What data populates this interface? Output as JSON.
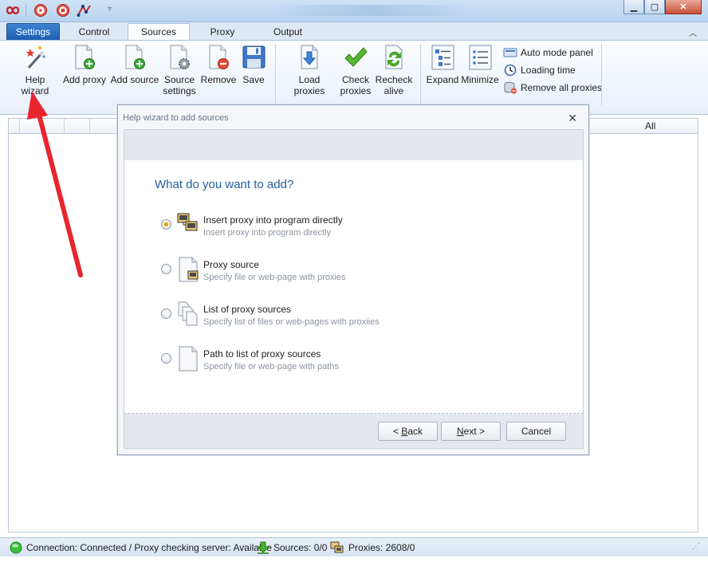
{
  "ribbon_tabs": [
    {
      "label": "Settings"
    },
    {
      "label": "Control"
    },
    {
      "label": "Sources"
    },
    {
      "label": "Proxy"
    },
    {
      "label": "Output"
    }
  ],
  "ribbon": {
    "help_wizard": "Help wizard",
    "add_proxy": "Add proxy",
    "add_source": "Add source",
    "source_settings_l1": "Source",
    "source_settings_l2": "settings",
    "remove": "Remove",
    "save": "Save",
    "load_proxies": "Load proxies",
    "check_proxies_l1": "Check",
    "check_proxies_l2": "proxies",
    "recheck_alive_l1": "Recheck",
    "recheck_alive_l2": "alive",
    "expand": "Expand",
    "minimize": "Minimize",
    "auto_mode_panel": "Auto mode panel",
    "loading_time": "Loading time",
    "remove_all_proxies": "Remove all proxies"
  },
  "grid": {
    "all_header": "All"
  },
  "dialog": {
    "title": "Help wizard to add sources",
    "heading": "What do you want to add?",
    "options": [
      {
        "title": "Insert proxy into program directly",
        "desc": "Insert proxy into program directly",
        "selected": true
      },
      {
        "title": "Proxy source",
        "desc": "Specify file or web-page with proxies",
        "selected": false
      },
      {
        "title": "List of proxy sources",
        "desc": "Specify list of files or web-pages with proxiies",
        "selected": false
      },
      {
        "title": "Path to list of proxy sources",
        "desc": "Specify file or web-page with paths",
        "selected": false
      }
    ],
    "back_prefix": "< ",
    "back_accel": "B",
    "back_rest": "ack",
    "next_accel": "N",
    "next_rest": "ext >",
    "cancel": "Cancel"
  },
  "status": {
    "connection": "Connection: Connected / Proxy checking server: Available",
    "sources": "Sources: 0/0",
    "proxies": "Proxies: 2608/0"
  },
  "colors": {
    "accent": "#1f5e9e",
    "arrow": "#e8242e",
    "active_tab": "#1e5fb2"
  }
}
